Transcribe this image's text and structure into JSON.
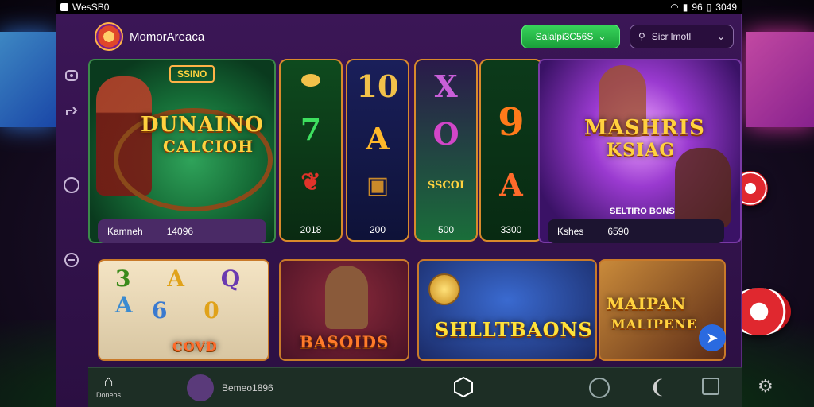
{
  "status_bar": {
    "carrier": "WesSB0",
    "battery": "3049",
    "signal": "96"
  },
  "header": {
    "app_name": "MomorAreaca",
    "balance_label": "Salalpi3C56S",
    "search_label": "Sicr lmotl"
  },
  "tiles": {
    "hero_left": {
      "title_top": "DUNAINO",
      "title_bottom": "CALCIOH",
      "sign": "SSINO",
      "caption_name": "Kamneh",
      "caption_value": "14096"
    },
    "reels": [
      {
        "top": "",
        "mid": "7",
        "bot": "",
        "value": "2018"
      },
      {
        "top": "10",
        "mid": "A",
        "bot": "",
        "value": "200"
      },
      {
        "top": "X",
        "mid": "O",
        "bot": "SSCOI",
        "value": "500"
      },
      {
        "top": "",
        "mid": "9",
        "bot": "A",
        "value": "3300"
      }
    ],
    "hero_right": {
      "title_top": "MASHRIS",
      "title_bottom": "KSIAG",
      "sub": "SELTIRO BONS",
      "caption_name": "Kshes",
      "caption_value": "6590"
    },
    "bottom": [
      {
        "title": "COVD"
      },
      {
        "title": "BASOIDS"
      },
      {
        "title": "SHLLTBAONS"
      },
      {
        "title_top": "MAIPAN",
        "title_bottom": "MALIPENE"
      }
    ]
  },
  "bottom_nav": {
    "home_label": "Doneos",
    "profile_label": "Bemeo1896"
  },
  "colors": {
    "accent_green": "#1a9f3a",
    "panel_purple": "#3b1656",
    "gold": "#ffd23f"
  }
}
